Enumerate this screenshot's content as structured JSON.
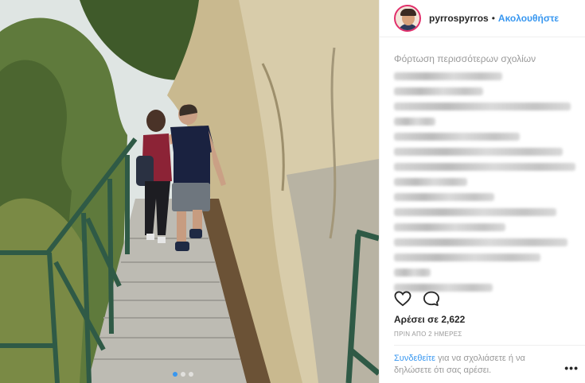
{
  "post": {
    "username": "pyrrospyrros",
    "separator": "•",
    "follow_label": "Ακολουθήστε",
    "load_more_label": "Φόρτωση περισσότερων σχολίων",
    "likes_label": "Αρέσει σε 2,622",
    "timestamp": "ΠΡΙΝ ΑΠΟ 2 ΗΜΕΡΕΣ",
    "login_link": "Συνδεθείτε",
    "login_text": "για να σχολιάσετε ή να δηλώσετε ότι σας αρέσει.",
    "more_label": "•••",
    "carousel_dots": 3,
    "active_dot": 1
  },
  "icons": {
    "like": "heart-outline-icon",
    "comment": "comment-bubble-icon",
    "more": "more-options-icon"
  },
  "colors": {
    "accent": "#3897f0",
    "text": "#262626",
    "muted": "#999999"
  }
}
